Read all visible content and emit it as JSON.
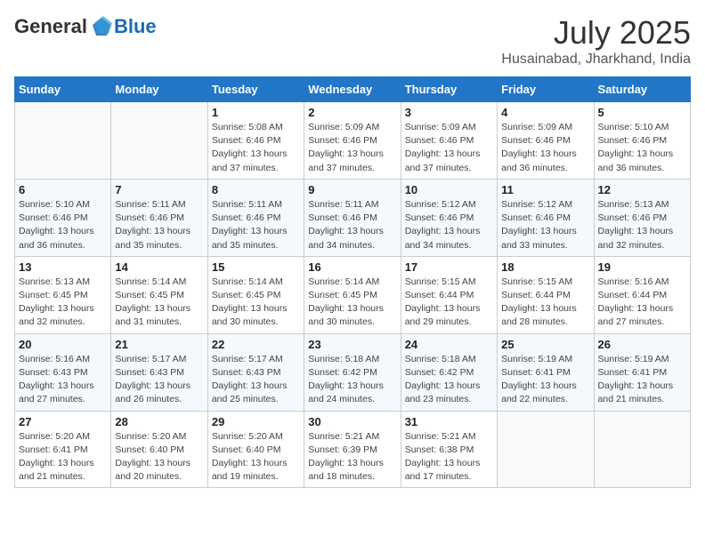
{
  "header": {
    "logo_general": "General",
    "logo_blue": "Blue",
    "month": "July 2025",
    "location": "Husainabad, Jharkhand, India"
  },
  "weekdays": [
    "Sunday",
    "Monday",
    "Tuesday",
    "Wednesday",
    "Thursday",
    "Friday",
    "Saturday"
  ],
  "weeks": [
    [
      {
        "day": "",
        "info": ""
      },
      {
        "day": "",
        "info": ""
      },
      {
        "day": "1",
        "info": "Sunrise: 5:08 AM\nSunset: 6:46 PM\nDaylight: 13 hours and 37 minutes."
      },
      {
        "day": "2",
        "info": "Sunrise: 5:09 AM\nSunset: 6:46 PM\nDaylight: 13 hours and 37 minutes."
      },
      {
        "day": "3",
        "info": "Sunrise: 5:09 AM\nSunset: 6:46 PM\nDaylight: 13 hours and 37 minutes."
      },
      {
        "day": "4",
        "info": "Sunrise: 5:09 AM\nSunset: 6:46 PM\nDaylight: 13 hours and 36 minutes."
      },
      {
        "day": "5",
        "info": "Sunrise: 5:10 AM\nSunset: 6:46 PM\nDaylight: 13 hours and 36 minutes."
      }
    ],
    [
      {
        "day": "6",
        "info": "Sunrise: 5:10 AM\nSunset: 6:46 PM\nDaylight: 13 hours and 36 minutes."
      },
      {
        "day": "7",
        "info": "Sunrise: 5:11 AM\nSunset: 6:46 PM\nDaylight: 13 hours and 35 minutes."
      },
      {
        "day": "8",
        "info": "Sunrise: 5:11 AM\nSunset: 6:46 PM\nDaylight: 13 hours and 35 minutes."
      },
      {
        "day": "9",
        "info": "Sunrise: 5:11 AM\nSunset: 6:46 PM\nDaylight: 13 hours and 34 minutes."
      },
      {
        "day": "10",
        "info": "Sunrise: 5:12 AM\nSunset: 6:46 PM\nDaylight: 13 hours and 34 minutes."
      },
      {
        "day": "11",
        "info": "Sunrise: 5:12 AM\nSunset: 6:46 PM\nDaylight: 13 hours and 33 minutes."
      },
      {
        "day": "12",
        "info": "Sunrise: 5:13 AM\nSunset: 6:46 PM\nDaylight: 13 hours and 32 minutes."
      }
    ],
    [
      {
        "day": "13",
        "info": "Sunrise: 5:13 AM\nSunset: 6:45 PM\nDaylight: 13 hours and 32 minutes."
      },
      {
        "day": "14",
        "info": "Sunrise: 5:14 AM\nSunset: 6:45 PM\nDaylight: 13 hours and 31 minutes."
      },
      {
        "day": "15",
        "info": "Sunrise: 5:14 AM\nSunset: 6:45 PM\nDaylight: 13 hours and 30 minutes."
      },
      {
        "day": "16",
        "info": "Sunrise: 5:14 AM\nSunset: 6:45 PM\nDaylight: 13 hours and 30 minutes."
      },
      {
        "day": "17",
        "info": "Sunrise: 5:15 AM\nSunset: 6:44 PM\nDaylight: 13 hours and 29 minutes."
      },
      {
        "day": "18",
        "info": "Sunrise: 5:15 AM\nSunset: 6:44 PM\nDaylight: 13 hours and 28 minutes."
      },
      {
        "day": "19",
        "info": "Sunrise: 5:16 AM\nSunset: 6:44 PM\nDaylight: 13 hours and 27 minutes."
      }
    ],
    [
      {
        "day": "20",
        "info": "Sunrise: 5:16 AM\nSunset: 6:43 PM\nDaylight: 13 hours and 27 minutes."
      },
      {
        "day": "21",
        "info": "Sunrise: 5:17 AM\nSunset: 6:43 PM\nDaylight: 13 hours and 26 minutes."
      },
      {
        "day": "22",
        "info": "Sunrise: 5:17 AM\nSunset: 6:43 PM\nDaylight: 13 hours and 25 minutes."
      },
      {
        "day": "23",
        "info": "Sunrise: 5:18 AM\nSunset: 6:42 PM\nDaylight: 13 hours and 24 minutes."
      },
      {
        "day": "24",
        "info": "Sunrise: 5:18 AM\nSunset: 6:42 PM\nDaylight: 13 hours and 23 minutes."
      },
      {
        "day": "25",
        "info": "Sunrise: 5:19 AM\nSunset: 6:41 PM\nDaylight: 13 hours and 22 minutes."
      },
      {
        "day": "26",
        "info": "Sunrise: 5:19 AM\nSunset: 6:41 PM\nDaylight: 13 hours and 21 minutes."
      }
    ],
    [
      {
        "day": "27",
        "info": "Sunrise: 5:20 AM\nSunset: 6:41 PM\nDaylight: 13 hours and 21 minutes."
      },
      {
        "day": "28",
        "info": "Sunrise: 5:20 AM\nSunset: 6:40 PM\nDaylight: 13 hours and 20 minutes."
      },
      {
        "day": "29",
        "info": "Sunrise: 5:20 AM\nSunset: 6:40 PM\nDaylight: 13 hours and 19 minutes."
      },
      {
        "day": "30",
        "info": "Sunrise: 5:21 AM\nSunset: 6:39 PM\nDaylight: 13 hours and 18 minutes."
      },
      {
        "day": "31",
        "info": "Sunrise: 5:21 AM\nSunset: 6:38 PM\nDaylight: 13 hours and 17 minutes."
      },
      {
        "day": "",
        "info": ""
      },
      {
        "day": "",
        "info": ""
      }
    ]
  ]
}
